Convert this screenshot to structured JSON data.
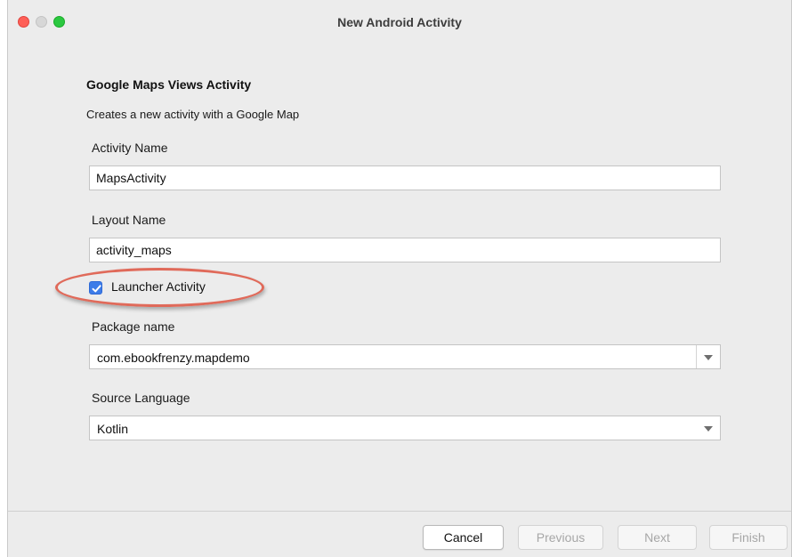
{
  "window": {
    "title": "New Android Activity"
  },
  "form": {
    "heading": "Google Maps Views Activity",
    "description": "Creates a new activity with a Google Map",
    "activity_name": {
      "label": "Activity Name",
      "value": "MapsActivity"
    },
    "layout_name": {
      "label": "Layout Name",
      "value": "activity_maps"
    },
    "launcher_activity": {
      "label": "Launcher Activity",
      "checked": true
    },
    "package_name": {
      "label": "Package name",
      "value": "com.ebookfrenzy.mapdemo"
    },
    "source_language": {
      "label": "Source Language",
      "value": "Kotlin"
    }
  },
  "footer": {
    "cancel": "Cancel",
    "previous": "Previous",
    "next": "Next",
    "finish": "Finish"
  },
  "colors": {
    "accent": "#3d7ce8",
    "highlight": "#e06a5a",
    "close": "#fe5f57",
    "maximize": "#2bc840"
  },
  "icons": {
    "checkbox": "checkmark-icon",
    "dropdown": "chevron-down-icon"
  }
}
